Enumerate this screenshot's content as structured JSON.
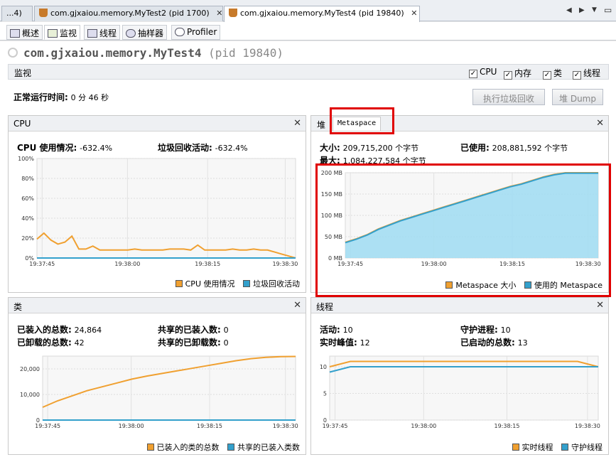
{
  "tabs": [
    {
      "label": "...4)",
      "close": "✕"
    },
    {
      "label": "com.gjxaiou.memory.MyTest2 (pid 1700)",
      "close": "✕"
    },
    {
      "label": "com.gjxaiou.memory.MyTest4 (pid 19840)",
      "close": "✕"
    }
  ],
  "nav": {
    "left": "◀",
    "right": "▶",
    "menu": "▼",
    "max": "▭"
  },
  "subtabs": [
    "概述",
    "监视",
    "线程",
    "抽样器",
    "Profiler"
  ],
  "app": {
    "name": "com.gjxaiou.memory.MyTest4",
    "pid": "(pid 19840)"
  },
  "monitor": {
    "title": "监视",
    "checks": [
      "CPU",
      "内存",
      "类",
      "线程"
    ],
    "check_mark": "✓"
  },
  "uptime": {
    "label": "正常运行时间:",
    "value": "0 分 46 秒"
  },
  "buttons": {
    "gc": "执行垃圾回收",
    "dump": "堆 Dump"
  },
  "cpu": {
    "title": "CPU",
    "close": "✕",
    "usage_label": "CPU 使用情况:",
    "usage_value": "-632.4%",
    "gc_label": "垃圾回收活动:",
    "gc_value": "-632.4%",
    "legend": [
      "CPU 使用情况",
      "垃圾回收活动"
    ]
  },
  "heap": {
    "tab_heap": "堆",
    "tab_meta": "Metaspace",
    "close": "✕",
    "size_label": "大小:",
    "size_value": "209,715,200 个字节",
    "used_label": "已使用:",
    "used_value": "208,881,592 个字节",
    "max_label": "最大:",
    "max_value": "1,084,227,584 个字节",
    "legend": [
      "Metaspace 大小",
      "使用的 Metaspace"
    ]
  },
  "classes": {
    "title": "类",
    "close": "✕",
    "loaded_label": "已装入的总数:",
    "loaded_value": "24,864",
    "shared_loaded_label": "共享的已装入数:",
    "shared_loaded_value": "0",
    "unloaded_label": "已卸载的总数:",
    "unloaded_value": "42",
    "shared_unloaded_label": "共享的已卸载数:",
    "shared_unloaded_value": "0",
    "legend": [
      "已装入的类的总数",
      "共享的已装入类数"
    ]
  },
  "threads": {
    "title": "线程",
    "close": "✕",
    "live_label": "活动:",
    "live_value": "10",
    "daemon_label": "守护进程:",
    "daemon_value": "10",
    "peak_label": "实时峰值:",
    "peak_value": "12",
    "started_label": "已启动的总数:",
    "started_value": "13",
    "legend": [
      "实时线程",
      "守护线程"
    ]
  },
  "colors": {
    "orange": "#f0a030",
    "blue": "#33a0cc",
    "red": "#e00000"
  },
  "chart_data": [
    {
      "type": "line",
      "name": "cpu",
      "x": [
        "19:37:45",
        "19:38:00",
        "19:38:15",
        "19:38:30"
      ],
      "ylim": [
        0,
        100
      ],
      "yticks": [
        "0%",
        "20%",
        "40%",
        "60%",
        "80%",
        "100%"
      ],
      "series": [
        {
          "name": "CPU 使用情况",
          "values": [
            19,
            25,
            18,
            14,
            16,
            22,
            9,
            9,
            12,
            8,
            8,
            8,
            8,
            8,
            9,
            8,
            8,
            8,
            8,
            9,
            9,
            9,
            8,
            13,
            8,
            8,
            8,
            8,
            9,
            8,
            8,
            9,
            8,
            8,
            6,
            4,
            2,
            0
          ]
        },
        {
          "name": "垃圾回收活动",
          "values": [
            0,
            0,
            0,
            0,
            0,
            0,
            0,
            0,
            0,
            0,
            0,
            0,
            0,
            0,
            0,
            0,
            0,
            0,
            0,
            0,
            0,
            0,
            0,
            0,
            0,
            0,
            0,
            0,
            0,
            0,
            0,
            0,
            0,
            0,
            0,
            0,
            0,
            0
          ]
        }
      ]
    },
    {
      "type": "area",
      "name": "metaspace",
      "x": [
        "19:37:45",
        "19:38:00",
        "19:38:15",
        "19:38:30"
      ],
      "ylim": [
        0,
        200
      ],
      "yticks": [
        "0 MB",
        "50 MB",
        "100 MB",
        "150 MB",
        "200 MB"
      ],
      "series": [
        {
          "name": "Metaspace 大小",
          "values": [
            37,
            45,
            55,
            68,
            78,
            88,
            96,
            104,
            112,
            120,
            128,
            136,
            144,
            152,
            160,
            168,
            174,
            182,
            190,
            196,
            200,
            200,
            200,
            200
          ]
        },
        {
          "name": "使用的 Metaspace",
          "values": [
            36,
            44,
            54,
            67,
            77,
            87,
            95,
            103,
            111,
            119,
            127,
            135,
            143,
            151,
            159,
            167,
            173,
            181,
            189,
            195,
            199,
            199,
            199,
            199
          ]
        }
      ]
    },
    {
      "type": "line",
      "name": "classes",
      "x": [
        "19:37:45",
        "19:38:00",
        "19:38:15",
        "19:38:30"
      ],
      "ylim": [
        0,
        25000
      ],
      "yticks": [
        "0",
        "10,000",
        "20,000"
      ],
      "series": [
        {
          "name": "已装入的类的总数",
          "values": [
            5000,
            7500,
            9500,
            11500,
            13000,
            14500,
            16000,
            17200,
            18200,
            19200,
            20200,
            21200,
            22200,
            23200,
            24000,
            24500,
            24800,
            24864
          ]
        },
        {
          "name": "共享的已装入类数",
          "values": [
            0,
            0,
            0,
            0,
            0,
            0,
            0,
            0,
            0,
            0,
            0,
            0,
            0,
            0,
            0,
            0,
            0,
            0
          ]
        }
      ]
    },
    {
      "type": "line",
      "name": "threads",
      "x": [
        "19:37:45",
        "19:38:00",
        "19:38:15",
        "19:38:30"
      ],
      "ylim": [
        0,
        12
      ],
      "yticks": [
        "0",
        "5",
        "10"
      ],
      "series": [
        {
          "name": "实时线程",
          "values": [
            10,
            11,
            11,
            11,
            11,
            11,
            11,
            11,
            11,
            11,
            11,
            11,
            11,
            10
          ]
        },
        {
          "name": "守护线程",
          "values": [
            9,
            10,
            10,
            10,
            10,
            10,
            10,
            10,
            10,
            10,
            10,
            10,
            10,
            10
          ]
        }
      ]
    }
  ]
}
